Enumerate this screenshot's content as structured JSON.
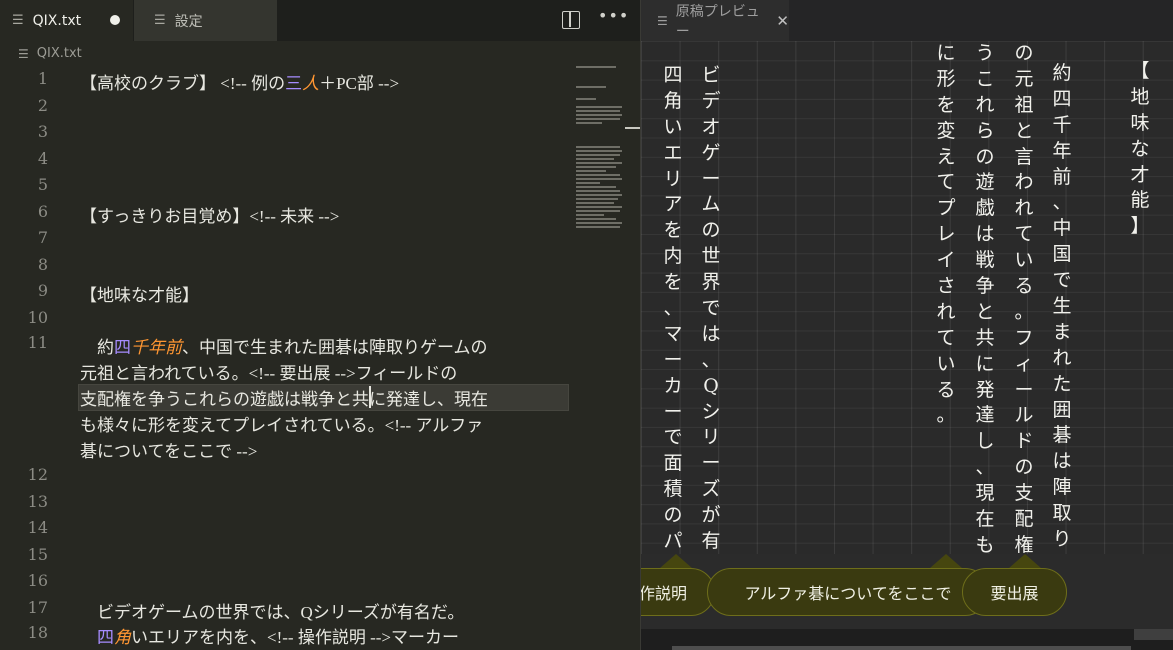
{
  "editor": {
    "tabs": [
      {
        "label": "QIX.txt",
        "icon": "file-lines-icon",
        "modified": true
      },
      {
        "label": "設定",
        "icon": "file-lines-icon"
      }
    ],
    "breadcrumb": "QIX.txt",
    "lines": [
      {
        "num": "1",
        "segments": [
          [
            "【高校のクラブ】 <!-- 例の",
            ""
          ],
          [
            "三",
            "purple"
          ],
          [
            "人",
            "orange"
          ],
          [
            "＋PC部 -->",
            ""
          ]
        ]
      },
      {
        "num": "2",
        "segments": []
      },
      {
        "num": "3",
        "segments": []
      },
      {
        "num": "4",
        "segments": []
      },
      {
        "num": "5",
        "segments": []
      },
      {
        "num": "6",
        "segments": [
          [
            "【すっきりお目覚め】<!-- 未来 -->",
            ""
          ]
        ]
      },
      {
        "num": "7",
        "segments": []
      },
      {
        "num": "8",
        "segments": []
      },
      {
        "num": "9",
        "segments": [
          [
            "【地味な才能】",
            ""
          ]
        ]
      },
      {
        "num": "10",
        "segments": []
      },
      {
        "num": "11",
        "segments": [
          [
            "　約",
            ""
          ],
          [
            "四",
            "purple"
          ],
          [
            "千年前",
            "orange"
          ],
          [
            "、中国で生まれた囲碁は陣取りゲームの",
            ""
          ]
        ]
      },
      {
        "num": "",
        "segments": [
          [
            "元祖と言われている。<!-- 要出展 -->フィールドの",
            ""
          ]
        ]
      },
      {
        "num": "",
        "segments": [
          [
            "支配権を争うこれらの遊戯は戦争と共に発達し、現在",
            ""
          ]
        ]
      },
      {
        "num": "",
        "segments": [
          [
            "も様々に形を変えてプレイされている。<!-- アルファ",
            ""
          ]
        ]
      },
      {
        "num": "",
        "segments": [
          [
            "碁についてをここで -->",
            ""
          ]
        ]
      },
      {
        "num": "12",
        "segments": []
      },
      {
        "num": "13",
        "segments": []
      },
      {
        "num": "14",
        "segments": []
      },
      {
        "num": "15",
        "segments": []
      },
      {
        "num": "16",
        "segments": []
      },
      {
        "num": "17",
        "segments": [
          [
            "　ビデオゲームの世界では、Qシリーズが有名だ。",
            ""
          ]
        ]
      },
      {
        "num": "18",
        "segments": [
          [
            "　",
            ""
          ],
          [
            "四",
            "purple"
          ],
          [
            "角",
            "orange"
          ],
          [
            "いエリアを内を、<!-- 操作説明 -->マーカー",
            ""
          ]
        ]
      }
    ]
  },
  "preview": {
    "tab_label": "原稿プレビュー",
    "columns": [
      "【地味な才能】",
      "約四千年前、中国で生まれた囲碁は陣取りゲーム",
      "の元祖と言われている。フィールドの支配権を争",
      "うこれらの遊戯は戦争と共に発達し、現在も様々",
      "に形を変えてプレイされている。",
      "ビデオゲームの世界では、Qシリーズが有名だ。",
      "四角いエリアを内を、マーカーで面積のパーセ"
    ],
    "highlight_char": "と",
    "notes": [
      "作説明",
      "アルファ碁についてをここで",
      "要出展"
    ]
  },
  "colors": {
    "editor_bg": "#272822",
    "purple_token": "#a68cff",
    "orange_token": "#ff9632",
    "note_bg": "#3a3a10"
  }
}
